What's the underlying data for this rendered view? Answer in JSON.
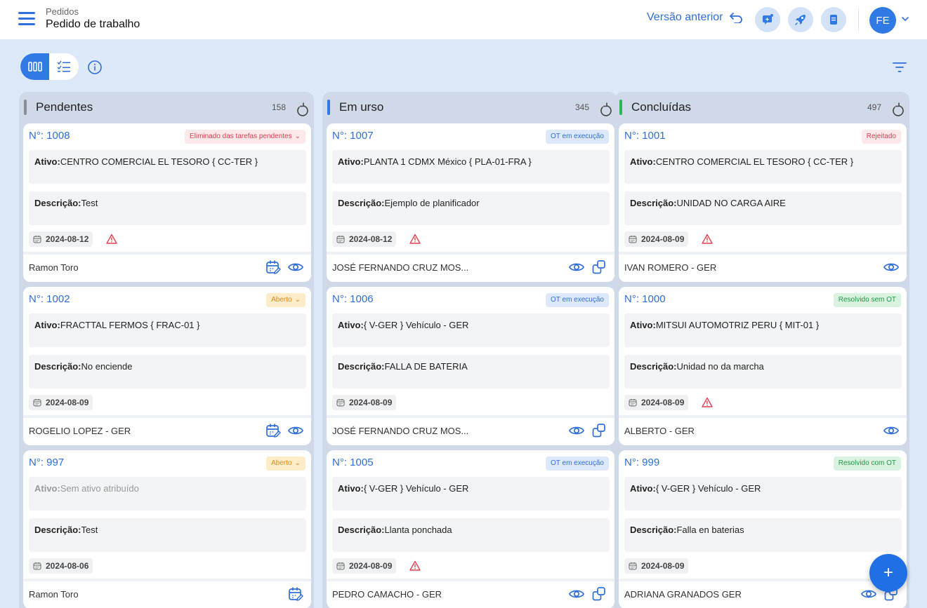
{
  "header": {
    "breadcrumb": "Pedidos",
    "title": "Pedido de trabalho",
    "prev_version": "Versão anterior",
    "avatar_initials": "FE"
  },
  "columns": [
    {
      "title": "Pendentes",
      "count": "158",
      "color": "#8a8f98",
      "cards": [
        {
          "number": "N°: 1008",
          "badge": "Eliminado das tarefas pendentes",
          "badge_style": "red",
          "badge_caret": true,
          "ativo_label": "Ativo:",
          "ativo": "CENTRO COMERCIAL EL TESORO   { CC-TER }",
          "desc_label": "Descrição:",
          "desc": "Test",
          "date": "2024-08-12",
          "warning": true,
          "person": "Ramon Toro",
          "actions": [
            "schedule-icon",
            "eye-icon"
          ]
        },
        {
          "number": "N°: 1002",
          "badge": "Aberto",
          "badge_style": "orange",
          "badge_caret": true,
          "ativo_label": "Ativo:",
          "ativo": "FRACTTAL FERMOS   { FRAC-01 }",
          "desc_label": "Descrição:",
          "desc": "No enciende",
          "date": "2024-08-09",
          "warning": false,
          "person": "ROGELIO LOPEZ - GER",
          "actions": [
            "schedule-icon",
            "eye-icon"
          ]
        },
        {
          "number": "N°: 997",
          "badge": "Aberto",
          "badge_style": "orange",
          "badge_caret": true,
          "ativo_label": "Ativo:",
          "ativo": "Sem ativo atribuído",
          "ativo_muted": true,
          "desc_label": "Descrição:",
          "desc": "Test",
          "date": "2024-08-06",
          "warning": false,
          "person": "Ramon Toro",
          "actions": [
            "schedule-icon"
          ]
        }
      ]
    },
    {
      "title": "Em urso",
      "count": "345",
      "color": "#2f7ae5",
      "cards": [
        {
          "number": "N°: 1007",
          "badge": "OT em execução",
          "badge_style": "blue",
          "badge_caret": false,
          "ativo_label": "Ativo:",
          "ativo": "PLANTA 1 CDMX México { PLA-01-FRA }",
          "desc_label": "Descrição:",
          "desc": "Ejemplo de planificador",
          "date": "2024-08-12",
          "warning": true,
          "person": "JOSÉ FERNANDO CRUZ MOS...",
          "actions": [
            "eye-icon",
            "copy-icon"
          ]
        },
        {
          "number": "N°: 1006",
          "badge": "OT em execução",
          "badge_style": "blue",
          "badge_caret": false,
          "ativo_label": "Ativo:",
          "ativo": "{ V-GER }  Vehículo - GER",
          "desc_label": "Descrição:",
          "desc": "FALLA DE BATERIA",
          "date": "2024-08-09",
          "warning": false,
          "person": "JOSÉ FERNANDO CRUZ MOS...",
          "actions": [
            "eye-icon",
            "copy-icon"
          ]
        },
        {
          "number": "N°: 1005",
          "badge": "OT em execução",
          "badge_style": "blue",
          "badge_caret": false,
          "ativo_label": "Ativo:",
          "ativo": "{ V-GER }  Vehículo - GER",
          "desc_label": "Descrição:",
          "desc": "Llanta ponchada",
          "date": "2024-08-09",
          "warning": true,
          "person": "PEDRO CAMACHO - GER",
          "actions": [
            "eye-icon",
            "copy-icon"
          ]
        }
      ]
    },
    {
      "title": "Concluídas",
      "count": "497",
      "color": "#2cb552",
      "cards": [
        {
          "number": "N°: 1001",
          "badge": "Rejeitado",
          "badge_style": "red",
          "badge_caret": false,
          "ativo_label": "Ativo:",
          "ativo": "CENTRO COMERCIAL EL TESORO   { CC-TER }",
          "desc_label": "Descrição:",
          "desc": "UNIDAD NO CARGA AIRE",
          "date": "2024-08-09",
          "warning": true,
          "person": "IVAN ROMERO - GER",
          "actions": [
            "eye-icon"
          ]
        },
        {
          "number": "N°: 1000",
          "badge": "Resolvido sem OT",
          "badge_style": "green",
          "badge_caret": false,
          "ativo_label": "Ativo:",
          "ativo": "MITSUI AUTOMOTRIZ  PERU { MIT-01 }",
          "desc_label": "Descrição:",
          "desc": "Unidad no da marcha",
          "date": "2024-08-09",
          "warning": true,
          "person": "ALBERTO - GER",
          "actions": [
            "eye-icon"
          ]
        },
        {
          "number": "N°: 999",
          "badge": "Resolvido com OT",
          "badge_style": "green",
          "badge_caret": false,
          "ativo_label": "Ativo:",
          "ativo": "{ V-GER }  Vehículo - GER",
          "desc_label": "Descrição:",
          "desc": "Falla en baterias",
          "date": "2024-08-09",
          "warning": false,
          "person": "ADRIANA GRANADOS GER",
          "actions": [
            "eye-icon",
            "copy-icon"
          ]
        }
      ]
    }
  ],
  "fab_label": "+"
}
